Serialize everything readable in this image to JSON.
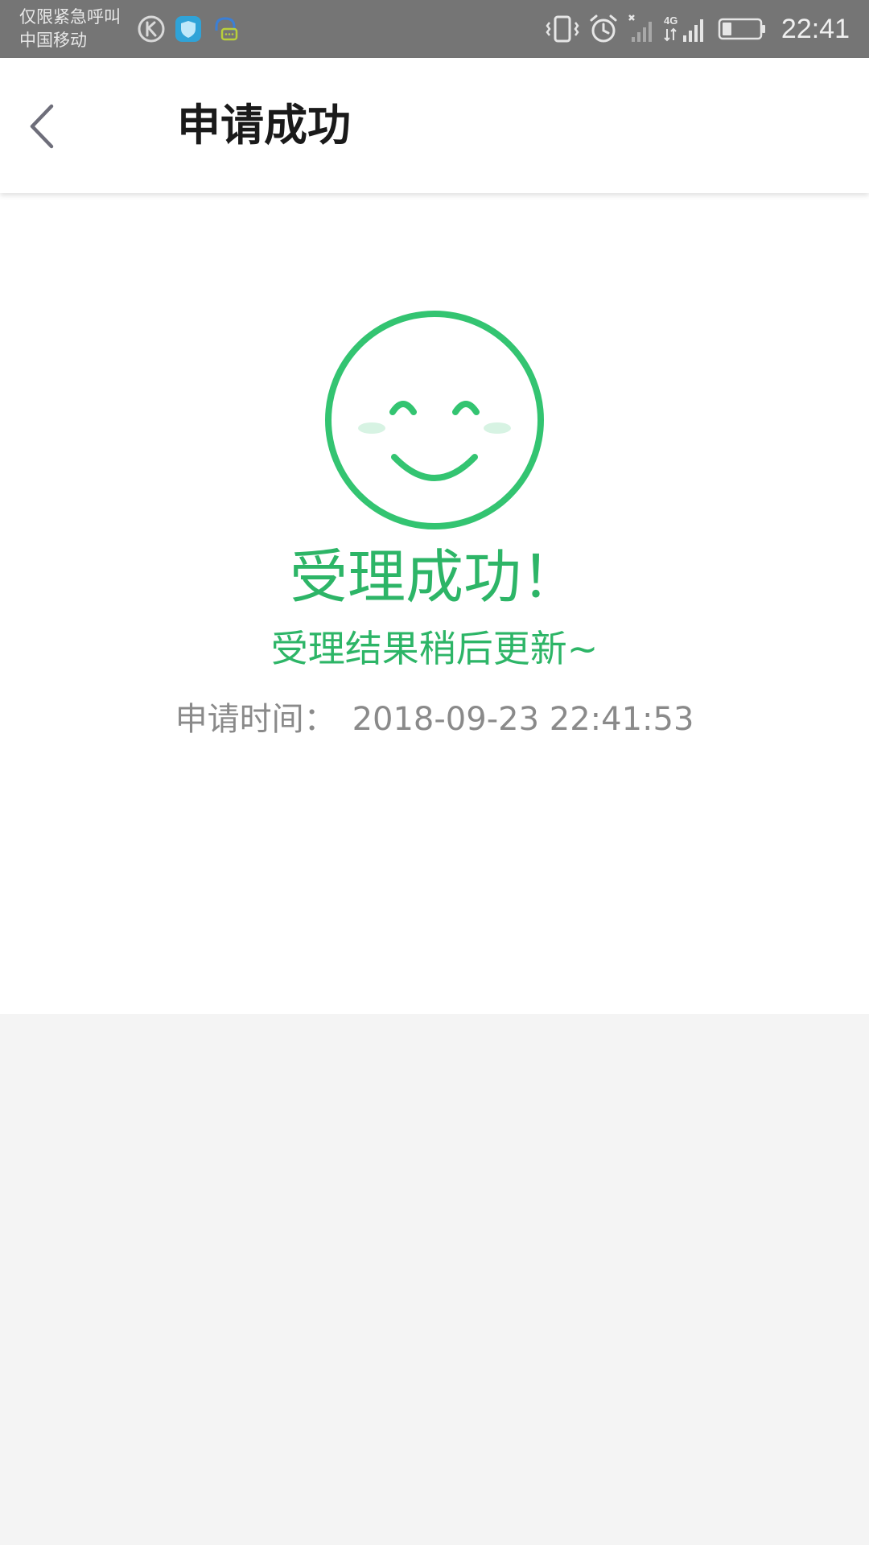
{
  "status_bar": {
    "carrier_line1": "仅限紧急呼叫",
    "carrier_line2": "中国移动",
    "app_icons": [
      "k-circle-icon",
      "shield-app-icon",
      "headset-chat-icon"
    ],
    "system_icons": [
      "vibrate-icon",
      "alarm-icon",
      "sim-no-signal-icon",
      "4g-signal-icon",
      "battery-icon"
    ],
    "network_label": "4G",
    "battery_level": 0.25,
    "time": "22:41"
  },
  "header": {
    "title": "申请成功",
    "back_icon": "chevron-left-icon"
  },
  "result": {
    "icon": "smiley-face-icon",
    "title": "受理成功！",
    "subtitle": "受理结果稍后更新~",
    "time_label": "申请时间：",
    "time_value": "2018-09-23 22:41:53"
  },
  "colors": {
    "accent": "#2db567",
    "smiley_stroke": "#33c471",
    "smiley_cheek": "#d7f3e3",
    "status_bar_bg": "#757575",
    "header_bg": "#ffffff",
    "page_bg": "#f4f4f4",
    "secondary_text": "#8a8a8a",
    "title_text": "#1a1a1a"
  }
}
